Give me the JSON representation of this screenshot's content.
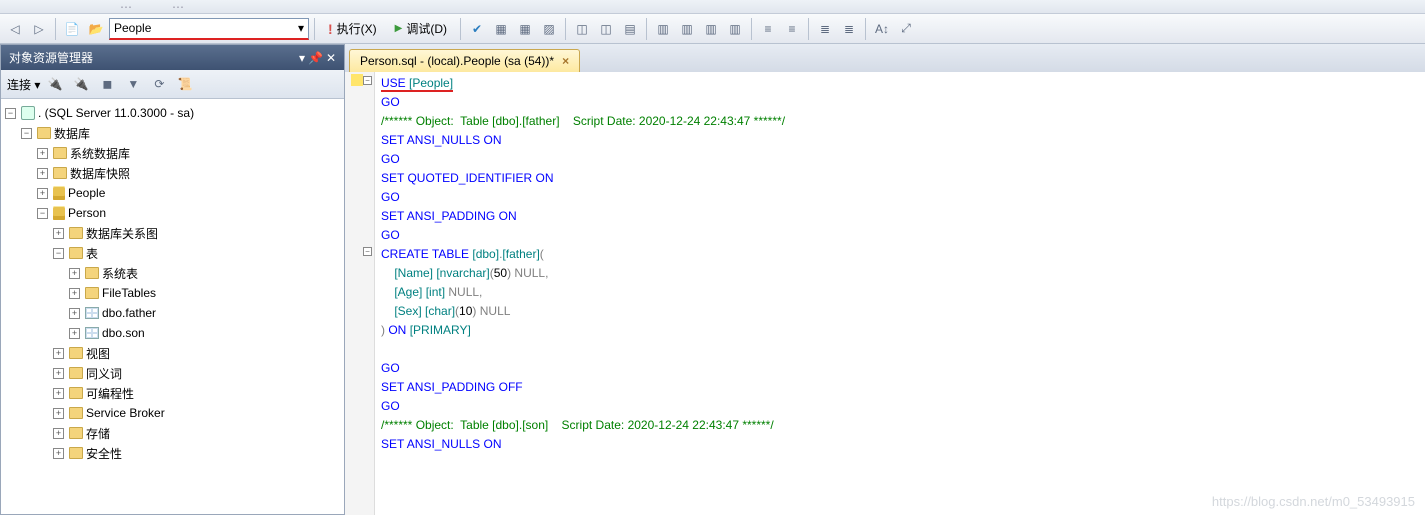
{
  "toolbar": {
    "db_selected": "People",
    "execute_label": "执行(X)",
    "debug_label": "调试(D)"
  },
  "object_explorer": {
    "title": "对象资源管理器",
    "connect_label": "连接 ▾",
    "server": ". (SQL Server 11.0.3000 - sa)",
    "nodes": {
      "databases": "数据库",
      "sysdb": "系统数据库",
      "dbsnap": "数据库快照",
      "people": "People",
      "person": "Person",
      "dbdiag": "数据库关系图",
      "tables": "表",
      "systables": "系统表",
      "filetables": "FileTables",
      "father": "dbo.father",
      "son": "dbo.son",
      "views": "视图",
      "synonyms": "同义词",
      "programmability": "可编程性",
      "servicebroker": "Service Broker",
      "storage": "存储",
      "security": "安全性"
    }
  },
  "tab": {
    "title": "Person.sql - (local).People (sa (54))*"
  },
  "code": {
    "l1a": "USE ",
    "l1b": "[People]",
    "l2": "GO",
    "l3": "/****** Object:  Table [dbo].[father]    Script Date: 2020-12-24 22:43:47 ******/",
    "l4a": "SET ",
    "l4b": "ANSI_NULLS ",
    "l4c": "ON",
    "l5": "GO",
    "l6a": "SET ",
    "l6b": "QUOTED_IDENTIFIER ",
    "l6c": "ON",
    "l7": "GO",
    "l8a": "SET ",
    "l8b": "ANSI_PADDING ",
    "l8c": "ON",
    "l9": "GO",
    "l10a": "CREATE ",
    "l10b": "TABLE ",
    "l10c": "[dbo]",
    "l10d": ".",
    "l10e": "[father]",
    "l10f": "(",
    "l11a": "    [Name] [nvarchar]",
    "l11b": "(",
    "l11c": "50",
    "l11d": ") ",
    "l11e": "NULL,",
    "l12a": "    [Age] [int] ",
    "l12b": "NULL,",
    "l13a": "    [Sex] [char]",
    "l13b": "(",
    "l13c": "10",
    "l13d": ") ",
    "l13e": "NULL",
    "l14a": ") ",
    "l14b": "ON ",
    "l14c": "[PRIMARY]",
    "l15": "",
    "l16": "GO",
    "l17a": "SET ",
    "l17b": "ANSI_PADDING ",
    "l17c": "OFF",
    "l18": "GO",
    "l19": "/****** Object:  Table [dbo].[son]    Script Date: 2020-12-24 22:43:47 ******/",
    "l20a": "SET ",
    "l20b": "ANSI_NULLS ",
    "l20c": "ON"
  },
  "watermark": "https://blog.csdn.net/m0_53493915"
}
